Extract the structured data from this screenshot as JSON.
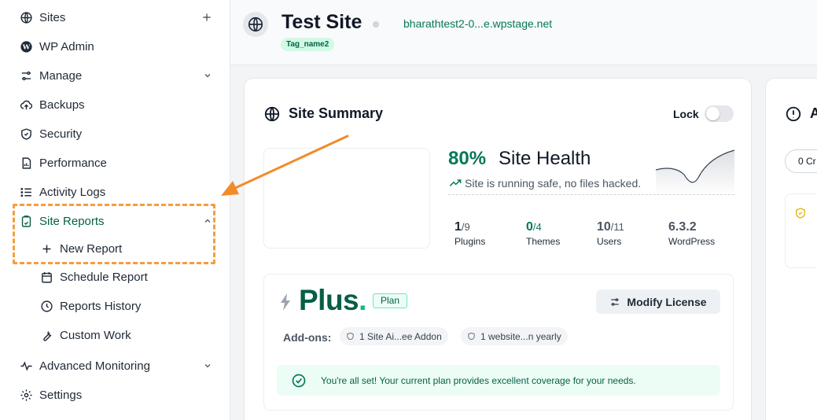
{
  "sidebar": {
    "items": [
      {
        "label": "Sites",
        "icon": "globe-icon"
      },
      {
        "label": "WP Admin",
        "icon": "wordpress-icon"
      },
      {
        "label": "Manage",
        "icon": "sliders-icon"
      },
      {
        "label": "Backups",
        "icon": "cloud-upload-icon"
      },
      {
        "label": "Security",
        "icon": "shield-icon"
      },
      {
        "label": "Performance",
        "icon": "document-chart-icon"
      },
      {
        "label": "Activity Logs",
        "icon": "list-icon"
      },
      {
        "label": "Site Reports",
        "icon": "report-icon"
      },
      {
        "label": "New Report",
        "icon": "plus-icon"
      },
      {
        "label": "Schedule Report",
        "icon": "calendar-icon"
      },
      {
        "label": "Reports History",
        "icon": "history-icon"
      },
      {
        "label": "Custom Work",
        "icon": "wrench-icon"
      },
      {
        "label": "Advanced Monitoring",
        "icon": "activity-icon"
      },
      {
        "label": "Settings",
        "icon": "gear-icon"
      }
    ]
  },
  "header": {
    "title": "Test Site",
    "url": "bharathtest2-0...e.wpstage.net",
    "tag": "Tag_name2"
  },
  "summary": {
    "title": "Site Summary",
    "lock_label": "Lock",
    "lock_on": false,
    "health_percent": "80%",
    "health_label": "Site Health",
    "health_message": "Site is running safe, no files hacked.",
    "stats": [
      {
        "value": "1",
        "total": "/9",
        "label": "Plugins"
      },
      {
        "value": "0",
        "total": "/4",
        "label": "Themes"
      },
      {
        "value": "10",
        "total": "/11",
        "label": "Users"
      },
      {
        "value": "6.3.2",
        "total": "",
        "label": "WordPress"
      }
    ]
  },
  "plan": {
    "name": "Plus",
    "dot": ".",
    "pill": "Plan",
    "modify_label": "Modify License",
    "addons_label": "Add-ons:",
    "addons": [
      "1 Site Ai...ee Addon",
      "1 website...n yearly"
    ],
    "status_message": "You're all set! Your current plan provides excellent coverage for your needs."
  },
  "right_card": {
    "title_partial": "A",
    "chip_partial": "0 Cr"
  },
  "colors": {
    "accent_green": "#047857",
    "highlight_orange": "#f59e3c"
  }
}
